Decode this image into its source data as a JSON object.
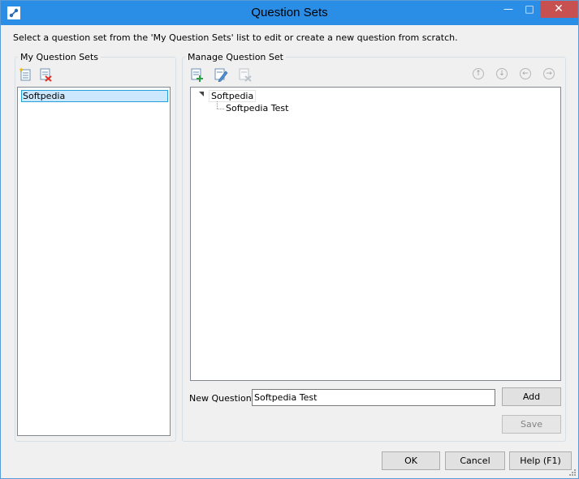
{
  "window": {
    "title": "Question Sets",
    "minimize_glyph": "—",
    "maximize_glyph": "□",
    "close_glyph": "✕"
  },
  "instructions": "Select a question set from the 'My Question Sets' list to edit or create a new question from scratch.",
  "my_question_sets": {
    "title": "My Question Sets",
    "items": [
      "Softpedia"
    ],
    "toolbar": [
      "add-set-icon",
      "delete-set-icon"
    ]
  },
  "manage_question_set": {
    "title": "Manage Question Set",
    "toolbar": [
      "add-question-icon",
      "edit-question-icon",
      "delete-question-icon"
    ],
    "nav": [
      "move-up-icon",
      "move-down-icon",
      "move-left-icon",
      "move-right-icon"
    ],
    "tree": {
      "root": "Softpedia",
      "children": [
        "Softpedia Test"
      ]
    }
  },
  "new_question": {
    "label": "New Question:",
    "value": "Softpedia Test",
    "add_label": "Add",
    "save_label": "Save"
  },
  "footer": {
    "ok_label": "OK",
    "cancel_label": "Cancel",
    "help_label": "Help (F1)"
  },
  "colors": {
    "titlebar": "#2b8ee6",
    "close": "#c75050",
    "selection": "#cce8ff"
  }
}
